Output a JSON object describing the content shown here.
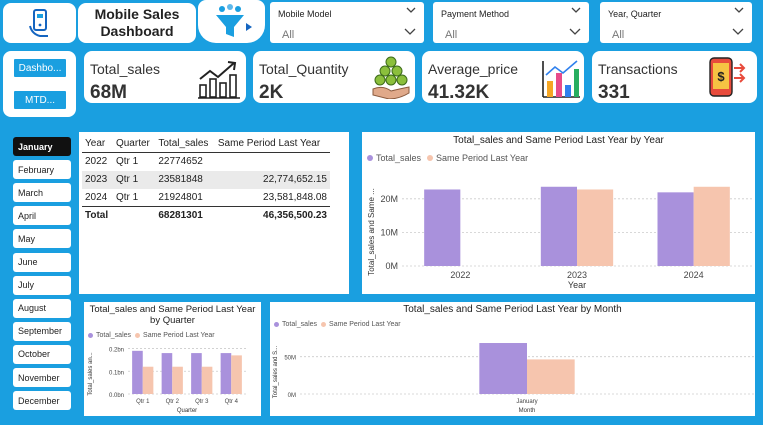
{
  "colors": {
    "background": "#1a9fe0",
    "total_sales": "#a991dc",
    "same_period": "#f6c5ae",
    "accent": "#1a9fe0"
  },
  "header": {
    "title_line1": "Mobile Sales",
    "title_line2": "Dashboard",
    "logo_icon": "phone-hand-icon",
    "filter_icon": "funnel-icon",
    "slicers": [
      {
        "label": "Mobile Model",
        "value": "All"
      },
      {
        "label": "Payment Method",
        "value": "All"
      },
      {
        "label": "Year, Quarter",
        "value": "All"
      }
    ]
  },
  "nav": {
    "dashboard": "Dashbo...",
    "mtd": "MTD..."
  },
  "kpis": [
    {
      "label": "Total_sales",
      "value": "68M",
      "icon": "bar-growth-icon"
    },
    {
      "label": "Total_Quantity",
      "value": "2K",
      "icon": "coins-stack-icon"
    },
    {
      "label": "Average_price",
      "value": "41.32K",
      "icon": "bar-chart-icon"
    },
    {
      "label": "Transactions",
      "value": "331",
      "icon": "mobile-payment-icon"
    }
  ],
  "months": [
    "January",
    "February",
    "March",
    "April",
    "May",
    "June",
    "July",
    "August",
    "September",
    "October",
    "November",
    "December"
  ],
  "selected_month": "January",
  "matrix": {
    "headers": [
      "Year",
      "Quarter",
      "Total_sales",
      "Same Period Last Year"
    ],
    "rows": [
      [
        "2022",
        "Qtr 1",
        "22774652",
        ""
      ],
      [
        "2023",
        "Qtr 1",
        "23581848",
        "22,774,652.15"
      ],
      [
        "2024",
        "Qtr 1",
        "21924801",
        "23,581,848.08"
      ]
    ],
    "total": [
      "Total",
      "",
      "68281301",
      "46,356,500.23"
    ]
  },
  "chart_data": [
    {
      "type": "bar",
      "title": "Total_sales and Same Period Last Year by Year",
      "xlabel": "Year",
      "ylabel": "Total_sales and Same ...",
      "categories": [
        "2022",
        "2023",
        "2024"
      ],
      "series": [
        {
          "name": "Total_sales",
          "values": [
            22774652,
            23581848,
            21924801
          ]
        },
        {
          "name": "Same Period Last Year",
          "values": [
            0,
            22774652,
            23581848
          ]
        }
      ],
      "ylim": [
        0,
        25000000
      ],
      "yticks": [
        "0M",
        "10M",
        "20M"
      ],
      "legend": "top-left"
    },
    {
      "type": "bar",
      "title": "Total_sales and Same Period Last Year by Quarter",
      "xlabel": "Quarter",
      "ylabel": "Total_sales an...",
      "categories": [
        "Qtr 1",
        "Qtr 2",
        "Qtr 3",
        "Qtr 4"
      ],
      "series": [
        {
          "name": "Total_sales",
          "values": [
            0.19,
            0.18,
            0.18,
            0.18
          ]
        },
        {
          "name": "Same Period Last Year",
          "values": [
            0.12,
            0.12,
            0.12,
            0.17
          ]
        }
      ],
      "ylim": [
        0,
        0.22
      ],
      "yticks": [
        "0.0bn",
        "0.1bn",
        "0.2bn"
      ],
      "legend": "top-left"
    },
    {
      "type": "bar",
      "title": "Total_sales and Same Period Last Year by Month",
      "xlabel": "Month",
      "ylabel": "Total_sales and S...",
      "categories": [
        "January"
      ],
      "series": [
        {
          "name": "Total_sales",
          "values": [
            68281301
          ]
        },
        {
          "name": "Same Period Last Year",
          "values": [
            46356500
          ]
        }
      ],
      "ylim": [
        0,
        75000000
      ],
      "yticks": [
        "0M",
        "50M"
      ],
      "legend": "top-left"
    }
  ]
}
